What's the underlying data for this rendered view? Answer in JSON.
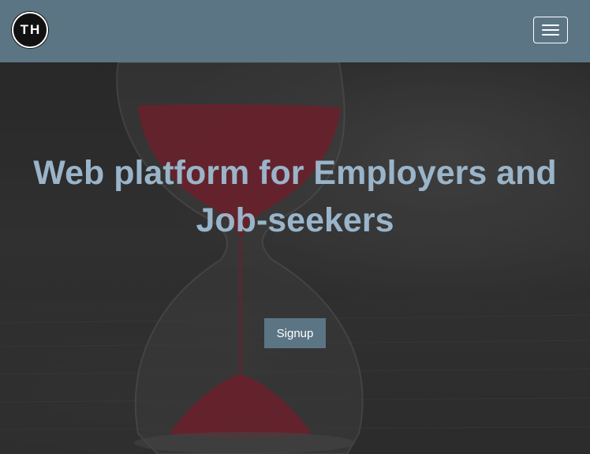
{
  "navbar": {
    "logo_text": "TH",
    "menu_toggle_icon": "hamburger-menu-icon"
  },
  "hero": {
    "headline": "Web platform for Employers and Job-seekers",
    "signup_label": "Signup",
    "background_image": "hourglass-photo"
  },
  "colors": {
    "navbar_bg": "#5c7585",
    "headline": "#9ab4c9",
    "button_bg": "#5c7585",
    "sand": "#8a2433"
  }
}
